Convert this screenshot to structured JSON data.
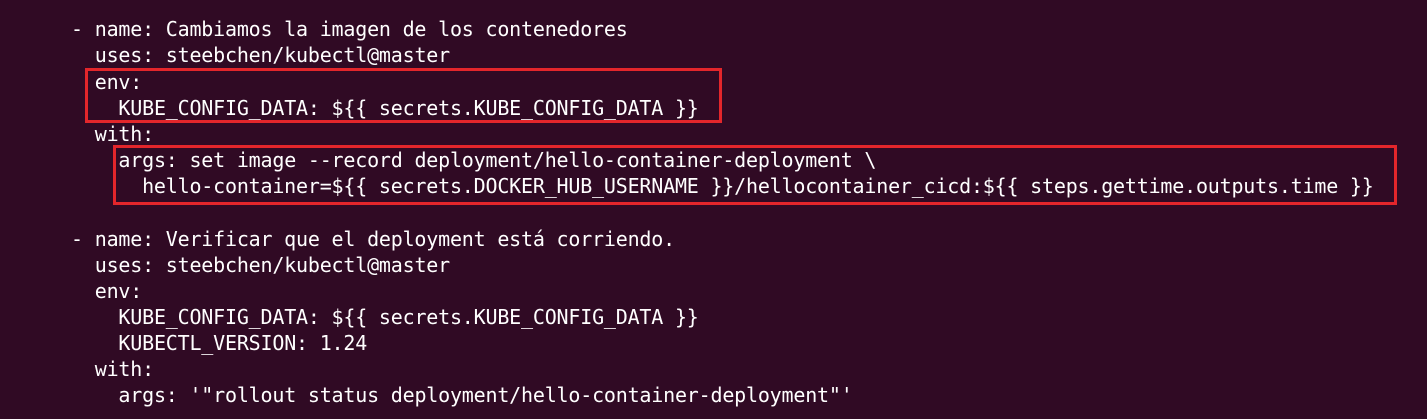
{
  "terminal": {
    "lines": [
      {
        "indent": "      ",
        "text": "- name: Cambiamos la imagen de los contenedores"
      },
      {
        "indent": "        ",
        "text": "uses: steebchen/kubectl@master"
      },
      {
        "indent": "        ",
        "text": "env:"
      },
      {
        "indent": "          ",
        "text": "KUBE_CONFIG_DATA: ${{ secrets.KUBE_CONFIG_DATA }}"
      },
      {
        "indent": "        ",
        "text": "with:"
      },
      {
        "indent": "          ",
        "text": "args: set image --record deployment/hello-container-deployment \\"
      },
      {
        "indent": "            ",
        "text": "hello-container=${{ secrets.DOCKER_HUB_USERNAME }}/hellocontainer_cicd:${{ steps.gettime.outputs.time }}"
      },
      {
        "indent": "",
        "text": ""
      },
      {
        "indent": "      ",
        "text": "- name: Verificar que el deployment está corriendo."
      },
      {
        "indent": "        ",
        "text": "uses: steebchen/kubectl@master"
      },
      {
        "indent": "        ",
        "text": "env:"
      },
      {
        "indent": "          ",
        "text": "KUBE_CONFIG_DATA: ${{ secrets.KUBE_CONFIG_DATA }}"
      },
      {
        "indent": "          ",
        "text": "KUBECTL_VERSION: 1.24"
      },
      {
        "indent": "        ",
        "text": "with:"
      },
      {
        "indent": "          ",
        "text": "args: '\"rollout status deployment/hello-container-deployment\"'"
      }
    ]
  },
  "colors": {
    "background": "#300a24",
    "text": "#ffffff",
    "highlight": "#e3262b"
  }
}
